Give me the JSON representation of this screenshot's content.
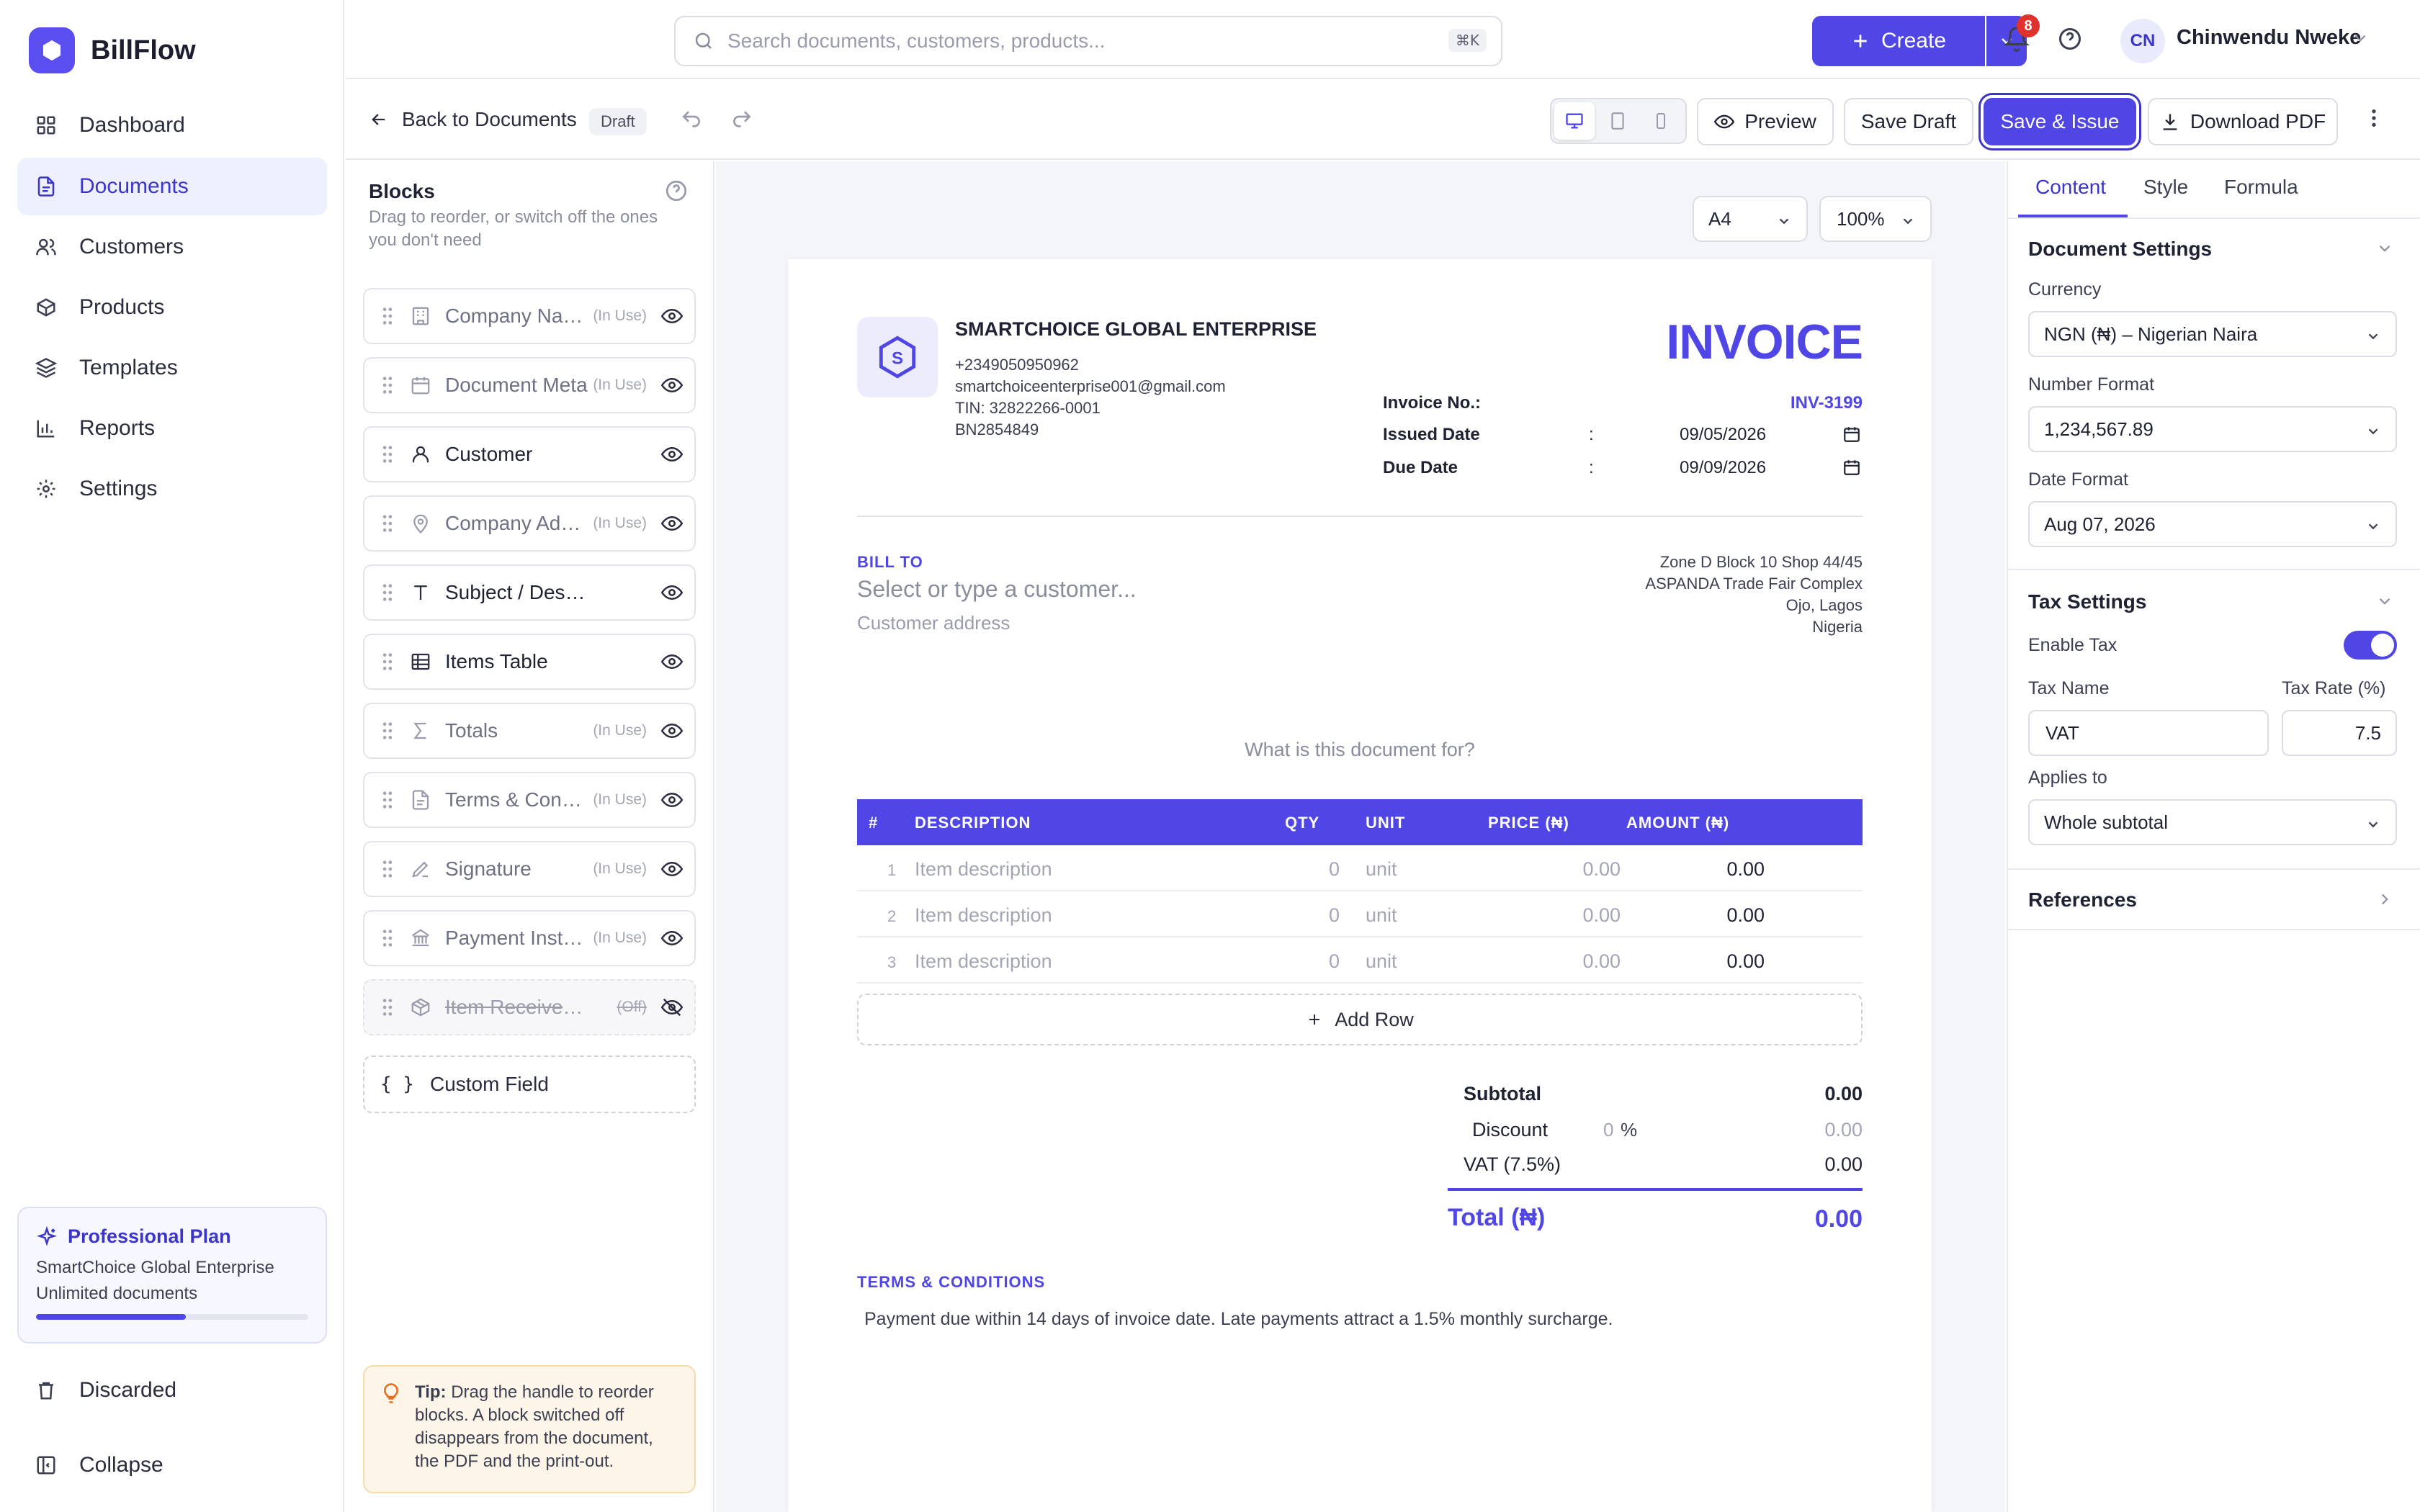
{
  "brand": {
    "name": "BillFlow",
    "accent": "#4f46e5"
  },
  "nav": {
    "items": [
      {
        "label": "Dashboard",
        "icon": "grid-icon"
      },
      {
        "label": "Documents",
        "icon": "file-icon",
        "active": true
      },
      {
        "label": "Customers",
        "icon": "users-icon"
      },
      {
        "label": "Products",
        "icon": "box-icon"
      },
      {
        "label": "Templates",
        "icon": "layers-icon"
      },
      {
        "label": "Reports",
        "icon": "bar-chart-icon"
      },
      {
        "label": "Settings",
        "icon": "gear-icon"
      }
    ],
    "discarded": "Discarded",
    "collapse": "Collapse"
  },
  "plan": {
    "title": "Professional Plan",
    "company": "SmartChoice Global Enterprise",
    "docs": "Unlimited documents",
    "progress": 0.55
  },
  "topbar": {
    "search_placeholder": "Search documents, customers, products...",
    "search_kbd": "⌘K",
    "create_label": "Create",
    "notifications": "8",
    "user_initials": "CN",
    "user_name": "Chinwendu Nweke"
  },
  "toolbar": {
    "back_label": "Back to Documents",
    "status": "Draft",
    "preview_label": "Preview",
    "save_draft_label": "Save Draft",
    "save_issue_label": "Save & Issue",
    "download_label": "Download PDF"
  },
  "blocks": {
    "title": "Blocks",
    "subtitle": "Drag to reorder, or switch off the ones you don't need",
    "items": [
      {
        "label": "Company Name",
        "tag": "(In Use)",
        "state": "inuse",
        "icon": "building-icon"
      },
      {
        "label": "Document Meta",
        "tag": "(In Use)",
        "state": "inuse",
        "icon": "calendar-icon"
      },
      {
        "label": "Customer",
        "tag": "",
        "state": "on",
        "icon": "user-icon"
      },
      {
        "label": "Company Addr...",
        "tag": "(In Use)",
        "state": "inuse",
        "icon": "map-pin-icon"
      },
      {
        "label": "Subject / Description",
        "tag": "",
        "state": "on",
        "icon": "text-icon"
      },
      {
        "label": "Items Table",
        "tag": "",
        "state": "on",
        "icon": "table-icon"
      },
      {
        "label": "Totals",
        "tag": "(In Use)",
        "state": "inuse",
        "icon": "sigma-icon"
      },
      {
        "label": "Terms & Condi...",
        "tag": "(In Use)",
        "state": "inuse",
        "icon": "document-icon"
      },
      {
        "label": "Signature",
        "tag": "(In Use)",
        "state": "inuse",
        "icon": "pen-icon"
      },
      {
        "label": "Payment Instru...",
        "tag": "(In Use)",
        "state": "inuse",
        "icon": "bank-icon"
      },
      {
        "label": "Item Received By",
        "tag": "(Off)",
        "state": "off",
        "icon": "package-icon"
      }
    ],
    "custom_field": "Custom Field",
    "tip_bold": "Tip:",
    "tip_text": " Drag the handle to reorder blocks. A block switched off disappears from the document, the PDF and the print-out."
  },
  "canvas": {
    "paper_size": "A4",
    "zoom": "100%"
  },
  "invoice": {
    "logo_letter": "S",
    "company_name": "SMARTCHOICE GLOBAL ENTERPRISE",
    "phone": "+2349050950962",
    "email": "smartchoiceenterprise001@gmail.com",
    "tin": "TIN: 32822266-0001",
    "bn": "BN2854849",
    "title": "INVOICE",
    "invoice_no_label": "Invoice No.:",
    "invoice_no": "INV-3199",
    "issued_label": "Issued Date",
    "issued_date": "09/05/2026",
    "due_label": "Due Date",
    "due_date": "09/09/2026",
    "colon": ":",
    "bill_to": "BILL TO",
    "customer_placeholder": "Select or type a customer...",
    "customer_address": "Customer address",
    "company_address": [
      "Zone D Block 10 Shop 44/45",
      "ASPANDA Trade Fair Complex",
      "Ojo, Lagos",
      "Nigeria"
    ],
    "subject_placeholder": "What is this document for?",
    "table_headers": {
      "num": "#",
      "desc": "DESCRIPTION",
      "qty": "QTY",
      "unit": "UNIT",
      "price": "PRICE (₦)",
      "amount": "AMOUNT (₦)"
    },
    "rows": [
      {
        "n": "1",
        "desc": "Item description",
        "qty": "0",
        "unit": "unit",
        "price": "0.00",
        "amount": "0.00"
      },
      {
        "n": "2",
        "desc": "Item description",
        "qty": "0",
        "unit": "unit",
        "price": "0.00",
        "amount": "0.00"
      },
      {
        "n": "3",
        "desc": "Item description",
        "qty": "0",
        "unit": "unit",
        "price": "0.00",
        "amount": "0.00"
      }
    ],
    "add_row": "Add Row",
    "subtotal_label": "Subtotal",
    "subtotal": "0.00",
    "discount_label": "Discount",
    "discount_pct": "0",
    "discount_pct_sign": "%",
    "discount": "0.00",
    "vat_label": "VAT (7.5%)",
    "vat": "0.00",
    "total_label": "Total (₦)",
    "total": "0.00",
    "terms_title": "TERMS & CONDITIONS",
    "terms_text": "Payment due within 14 days of invoice date. Late payments attract a 1.5% monthly surcharge."
  },
  "right": {
    "tabs": [
      "Content",
      "Style",
      "Formula"
    ],
    "doc_settings": "Document Settings",
    "currency_label": "Currency",
    "currency": "NGN (₦) – Nigerian Naira",
    "number_format_label": "Number Format",
    "number_format": "1,234,567.89",
    "date_format_label": "Date Format",
    "date_format": "Aug 07, 2026",
    "tax_settings": "Tax Settings",
    "enable_tax_label": "Enable Tax",
    "tax_enabled": true,
    "tax_name_label": "Tax Name",
    "tax_name": "VAT",
    "tax_rate_label": "Tax Rate (%)",
    "tax_rate": "7.5",
    "applies_to_label": "Applies to",
    "applies_to": "Whole subtotal",
    "references": "References"
  }
}
